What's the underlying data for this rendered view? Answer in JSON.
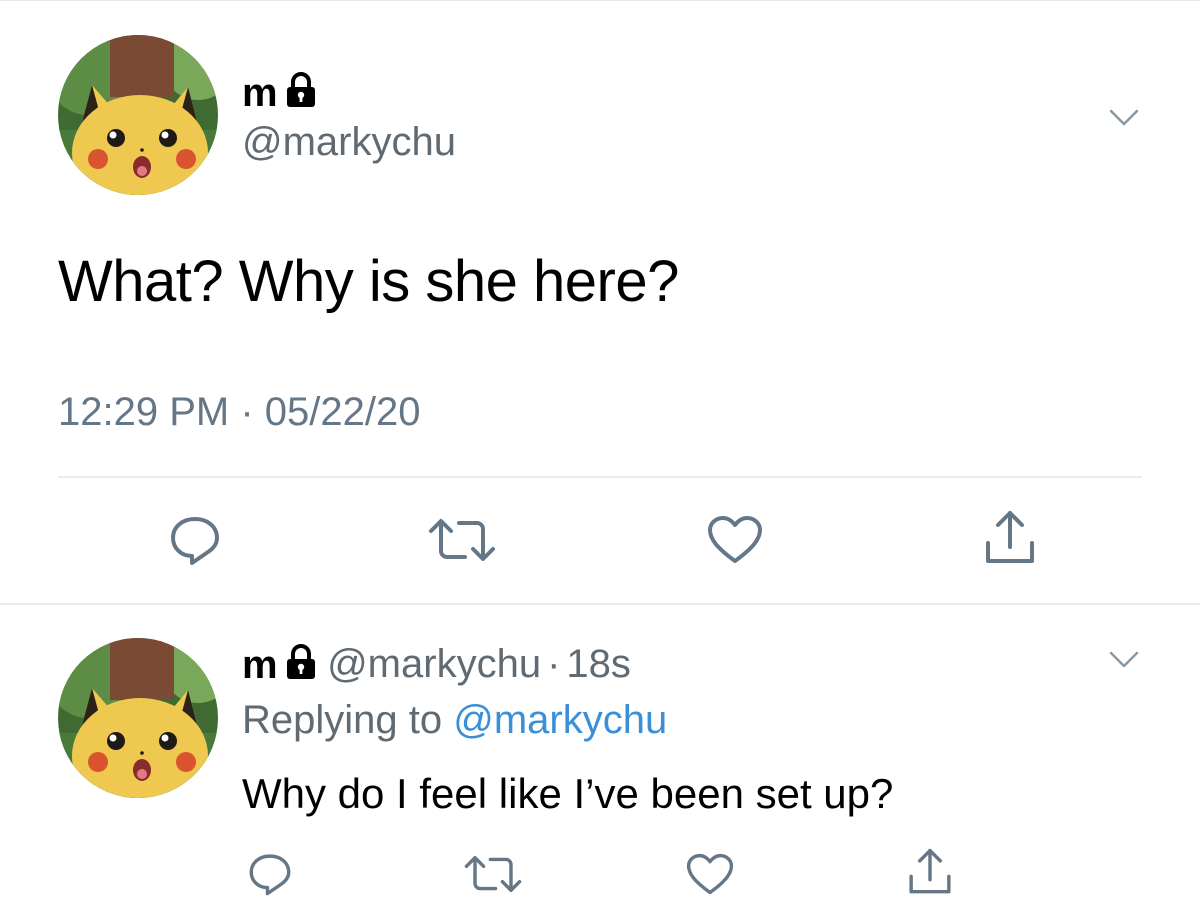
{
  "colors": {
    "text_primary": "#000000",
    "text_secondary": "#657786",
    "link": "#3a8fd9",
    "divider": "#e6ecf0",
    "icon": "#657786"
  },
  "main_tweet": {
    "display_name": "m",
    "protected_icon": "lock-icon",
    "handle": "@markychu",
    "text": "What? Why is she here?",
    "timestamp": "12:29 PM · 05/22/20",
    "menu_icon": "chevron-down-icon",
    "actions": [
      "reply-icon",
      "retweet-icon",
      "like-icon",
      "share-icon"
    ]
  },
  "reply_tweet": {
    "display_name": "m",
    "protected_icon": "lock-icon",
    "handle": "@markychu",
    "separator": "·",
    "time": "18s",
    "replying_label": "Replying to",
    "replying_to": "@markychu",
    "text": "Why do I feel like I’ve been set up?",
    "menu_icon": "chevron-down-icon",
    "actions": [
      "reply-icon",
      "retweet-icon",
      "like-icon",
      "share-icon"
    ]
  }
}
